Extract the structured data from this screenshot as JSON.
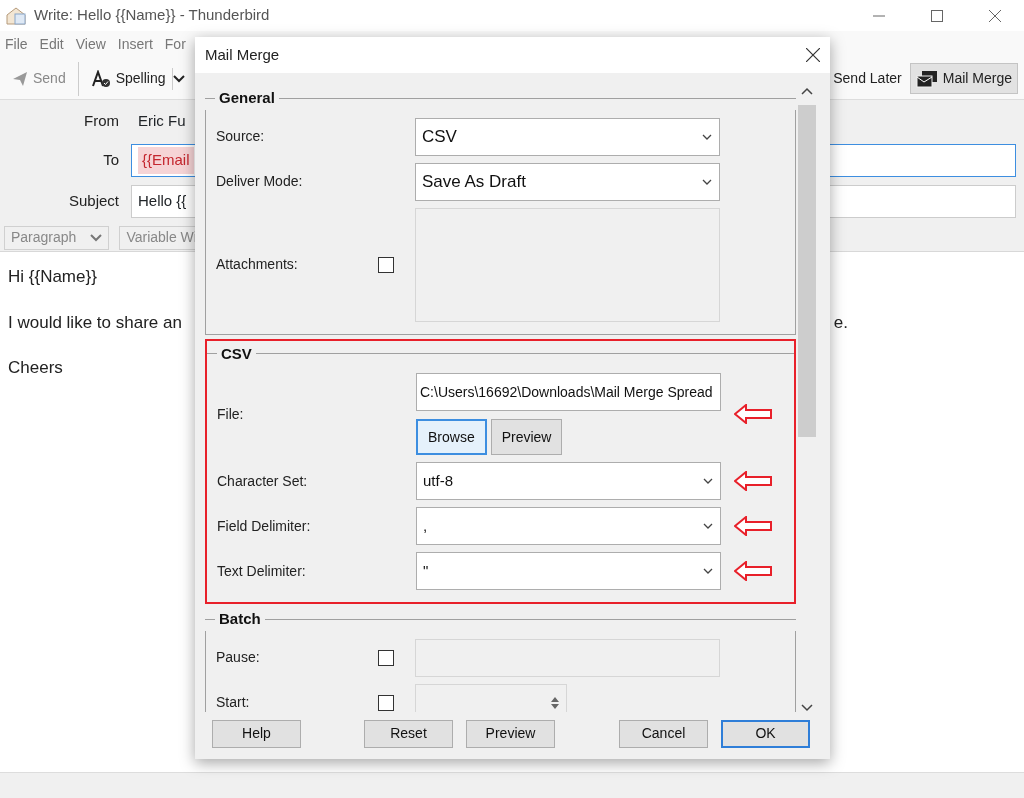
{
  "window": {
    "title": "Write: Hello {{Name}} - Thunderbird"
  },
  "menu": [
    {
      "label": "File"
    },
    {
      "label": "Edit"
    },
    {
      "label": "View"
    },
    {
      "label": "Insert"
    },
    {
      "label": "For"
    }
  ],
  "toolbar": {
    "send": {
      "label": "Send",
      "disabled": true
    },
    "spelling": {
      "label": "Spelling"
    },
    "send_later": {
      "label": "Send Later"
    },
    "mail_merge": {
      "label": "Mail Merge",
      "selected": true
    }
  },
  "header": {
    "from_label": "From",
    "from_value": "Eric Fu",
    "to_label": "To",
    "to_chip": "{{Email",
    "subject_label": "Subject",
    "subject_value": "Hello {{"
  },
  "format_bar": [
    {
      "label": "Paragraph",
      "kind": "dropdown"
    },
    {
      "label": "Variable Wi",
      "kind": "plain"
    }
  ],
  "body": [
    {
      "left": "Hi {{Name}}"
    },
    {
      "left": "I would like to share an",
      "right": "e."
    },
    {
      "left": "Cheers"
    }
  ],
  "dialog": {
    "title": "Mail Merge",
    "sections": [
      {
        "title": "General",
        "highlighted": false,
        "fields": [
          {
            "kind": "select",
            "label": "Source:",
            "value": "CSV",
            "annotated": false
          },
          {
            "kind": "select",
            "label": "Deliver Mode:",
            "value": "Save As Draft",
            "annotated": false
          },
          {
            "kind": "attachments",
            "label": "Attachments:",
            "checked": false
          }
        ]
      },
      {
        "title": "CSV",
        "highlighted": true,
        "fields": [
          {
            "kind": "file",
            "label": "File:",
            "value": "C:\\Users\\16692\\Downloads\\Mail Merge Spread",
            "annotated": true,
            "buttons": [
              {
                "label": "Browse",
                "selected": true
              },
              {
                "label": "Preview",
                "selected": false
              }
            ]
          },
          {
            "kind": "select",
            "label": "Character Set:",
            "value": "utf-8",
            "annotated": true
          },
          {
            "kind": "select",
            "label": "Field Delimiter:",
            "value": ",",
            "annotated": true
          },
          {
            "kind": "select",
            "label": "Text Delimiter:",
            "value": "\"",
            "annotated": true
          }
        ]
      },
      {
        "title": "Batch",
        "highlighted": false,
        "fields": [
          {
            "kind": "checkbox_input",
            "label": "Pause:",
            "checked": false
          },
          {
            "kind": "checkbox_spinner",
            "label": "Start:",
            "checked": false
          }
        ]
      }
    ],
    "buttons": [
      {
        "label": "Help",
        "default": false
      },
      {
        "label": "Reset",
        "default": false
      },
      {
        "label": "Preview",
        "default": false
      },
      {
        "label": "Cancel",
        "default": false
      },
      {
        "label": "OK",
        "default": true
      }
    ]
  }
}
